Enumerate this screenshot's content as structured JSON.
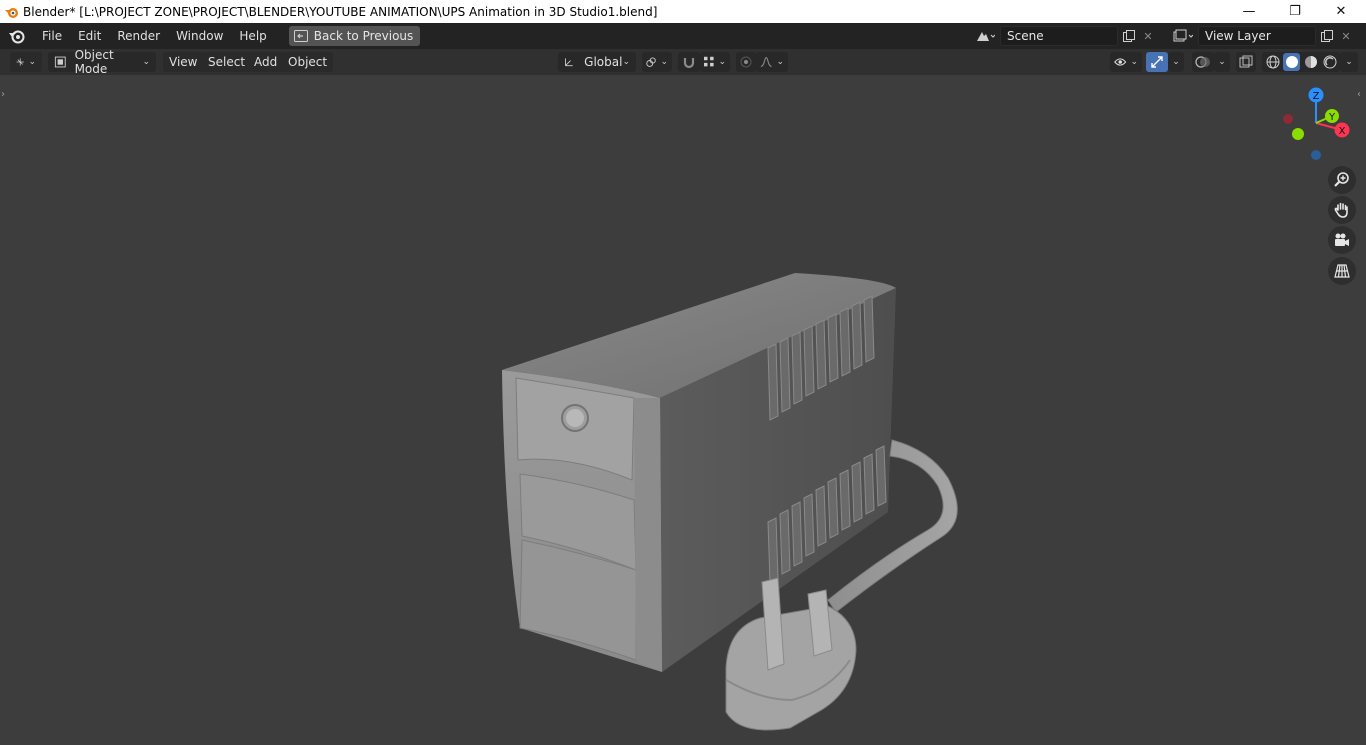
{
  "window": {
    "title": "Blender* [L:\\PROJECT ZONE\\PROJECT\\BLENDER\\YOUTUBE ANIMATION\\UPS Animation in 3D Studio1.blend]",
    "minimize": "—",
    "maximize": "❐",
    "close": "✕"
  },
  "menu": {
    "items": [
      "File",
      "Edit",
      "Render",
      "Window",
      "Help"
    ],
    "back_label": "Back to Previous"
  },
  "scene": {
    "name": "Scene",
    "view_layer": "View Layer"
  },
  "viewport_header": {
    "mode": "Object Mode",
    "menus": [
      "View",
      "Select",
      "Add",
      "Object"
    ],
    "orientation": "Global"
  },
  "gizmo": {
    "x": "X",
    "y": "Y",
    "z": "Z"
  },
  "icons": {
    "app": "blender-icon",
    "editor_type": "viewport-editor-icon",
    "transform_orientation": "orientation-icon",
    "pivot": "pivot-icon",
    "snap": "snap-magnet-icon",
    "proportional": "proportional-editing-icon",
    "visibility": "eye-icon",
    "gizmos": "gizmo-icon",
    "overlays": "overlay-icon",
    "xray": "xray-icon",
    "shading": [
      "wireframe-shading-icon",
      "solid-shading-icon",
      "material-shading-icon",
      "rendered-shading-icon"
    ],
    "zoom": "zoom-icon",
    "pan": "hand-icon",
    "camera": "camera-icon",
    "grid": "perspective-grid-icon"
  },
  "colors": {
    "accent": "#4772b3",
    "x_axis": "#ff3352",
    "y_axis": "#8bdc00",
    "z_axis": "#2890ff",
    "viewport_bg": "#3d3d3d"
  }
}
